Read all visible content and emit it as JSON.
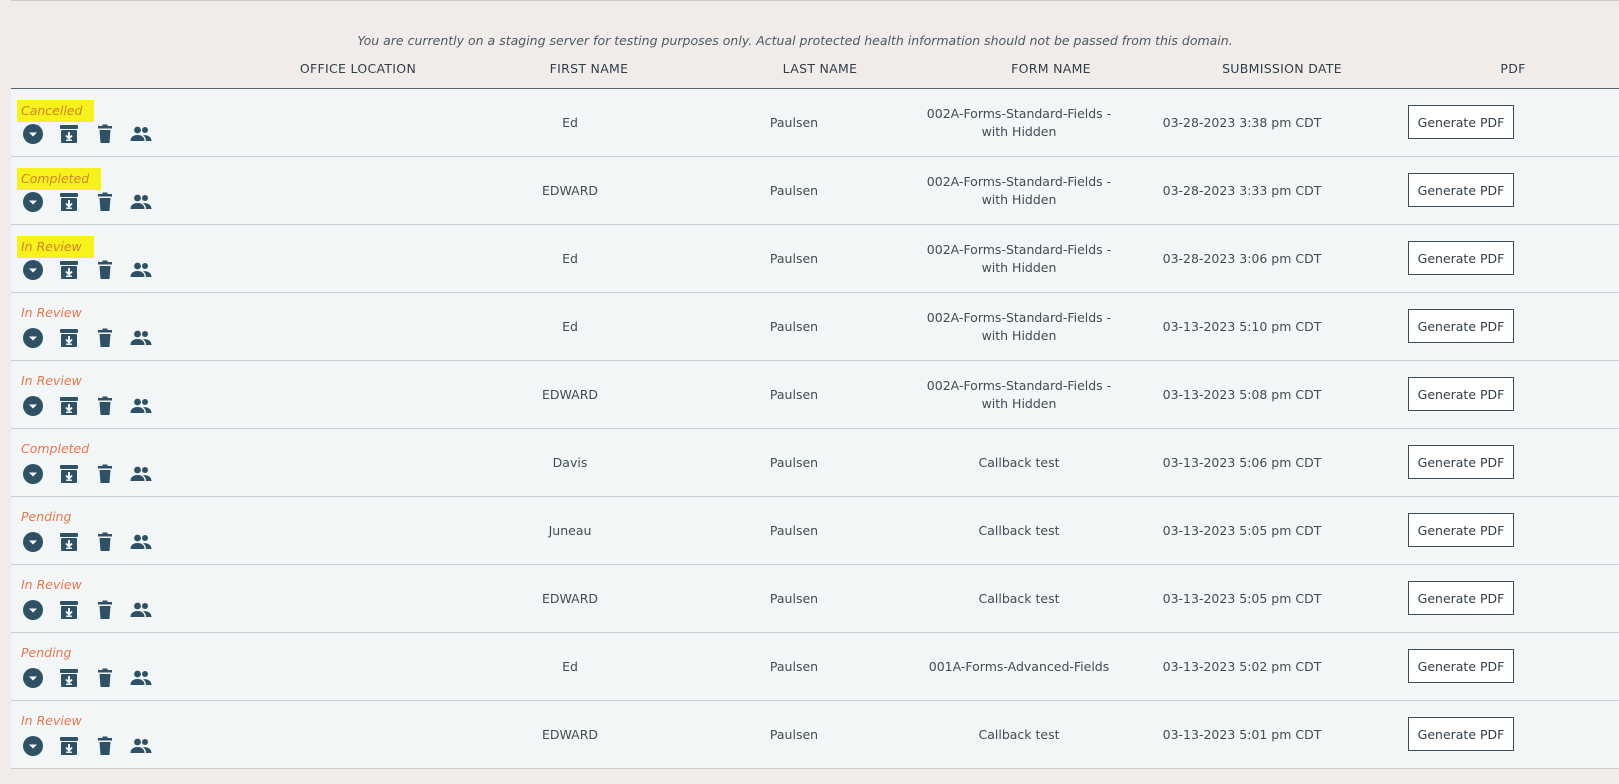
{
  "notice": "You are currently on a staging server for testing purposes only. Actual protected health information should not be passed from this domain.",
  "headers": {
    "office_location": "OFFICE LOCATION",
    "first_name": "FIRST NAME",
    "last_name": "LAST NAME",
    "form_name": "FORM NAME",
    "submission_date": "SUBMISSION DATE",
    "pdf": "PDF"
  },
  "icons": [
    "chevron-down-circle-icon",
    "archive-download-icon",
    "trash-icon",
    "people-icon"
  ],
  "colors": {
    "status_text": "#e7764a",
    "highlight": "#f6f21a",
    "icon": "#2f5166"
  },
  "rows": [
    {
      "status": "Cancelled",
      "highlighted": true,
      "first_name": "Ed",
      "last_name": "Paulsen",
      "form_name": "002A-Forms-Standard-Fields - with Hidden",
      "submission_date": "03-28-2023 3:38 pm CDT",
      "pdf_label": "Generate PDF"
    },
    {
      "status": "Completed",
      "highlighted": true,
      "first_name": "EDWARD",
      "last_name": "Paulsen",
      "form_name": "002A-Forms-Standard-Fields - with Hidden",
      "submission_date": "03-28-2023 3:33 pm CDT",
      "pdf_label": "Generate PDF"
    },
    {
      "status": "In Review",
      "highlighted": true,
      "first_name": "Ed",
      "last_name": "Paulsen",
      "form_name": "002A-Forms-Standard-Fields - with Hidden",
      "submission_date": "03-28-2023 3:06 pm CDT",
      "pdf_label": "Generate PDF"
    },
    {
      "status": "In Review",
      "highlighted": false,
      "first_name": "Ed",
      "last_name": "Paulsen",
      "form_name": "002A-Forms-Standard-Fields - with Hidden",
      "submission_date": "03-13-2023 5:10 pm CDT",
      "pdf_label": "Generate PDF"
    },
    {
      "status": "In Review",
      "highlighted": false,
      "first_name": "EDWARD",
      "last_name": "Paulsen",
      "form_name": "002A-Forms-Standard-Fields - with Hidden",
      "submission_date": "03-13-2023 5:08 pm CDT",
      "pdf_label": "Generate PDF"
    },
    {
      "status": "Completed",
      "highlighted": false,
      "first_name": "Davis",
      "last_name": "Paulsen",
      "form_name": "Callback test",
      "submission_date": "03-13-2023 5:06 pm CDT",
      "pdf_label": "Generate PDF"
    },
    {
      "status": "Pending",
      "highlighted": false,
      "first_name": "Juneau",
      "last_name": "Paulsen",
      "form_name": "Callback test",
      "submission_date": "03-13-2023 5:05 pm CDT",
      "pdf_label": "Generate PDF"
    },
    {
      "status": "In Review",
      "highlighted": false,
      "first_name": "EDWARD",
      "last_name": "Paulsen",
      "form_name": "Callback test",
      "submission_date": "03-13-2023 5:05 pm CDT",
      "pdf_label": "Generate PDF"
    },
    {
      "status": "Pending",
      "highlighted": false,
      "first_name": "Ed",
      "last_name": "Paulsen",
      "form_name": "001A-Forms-Advanced-Fields",
      "submission_date": "03-13-2023 5:02 pm CDT",
      "pdf_label": "Generate PDF"
    },
    {
      "status": "In Review",
      "highlighted": false,
      "first_name": "EDWARD",
      "last_name": "Paulsen",
      "form_name": "Callback test",
      "submission_date": "03-13-2023 5:01 pm CDT",
      "pdf_label": "Generate PDF"
    }
  ]
}
